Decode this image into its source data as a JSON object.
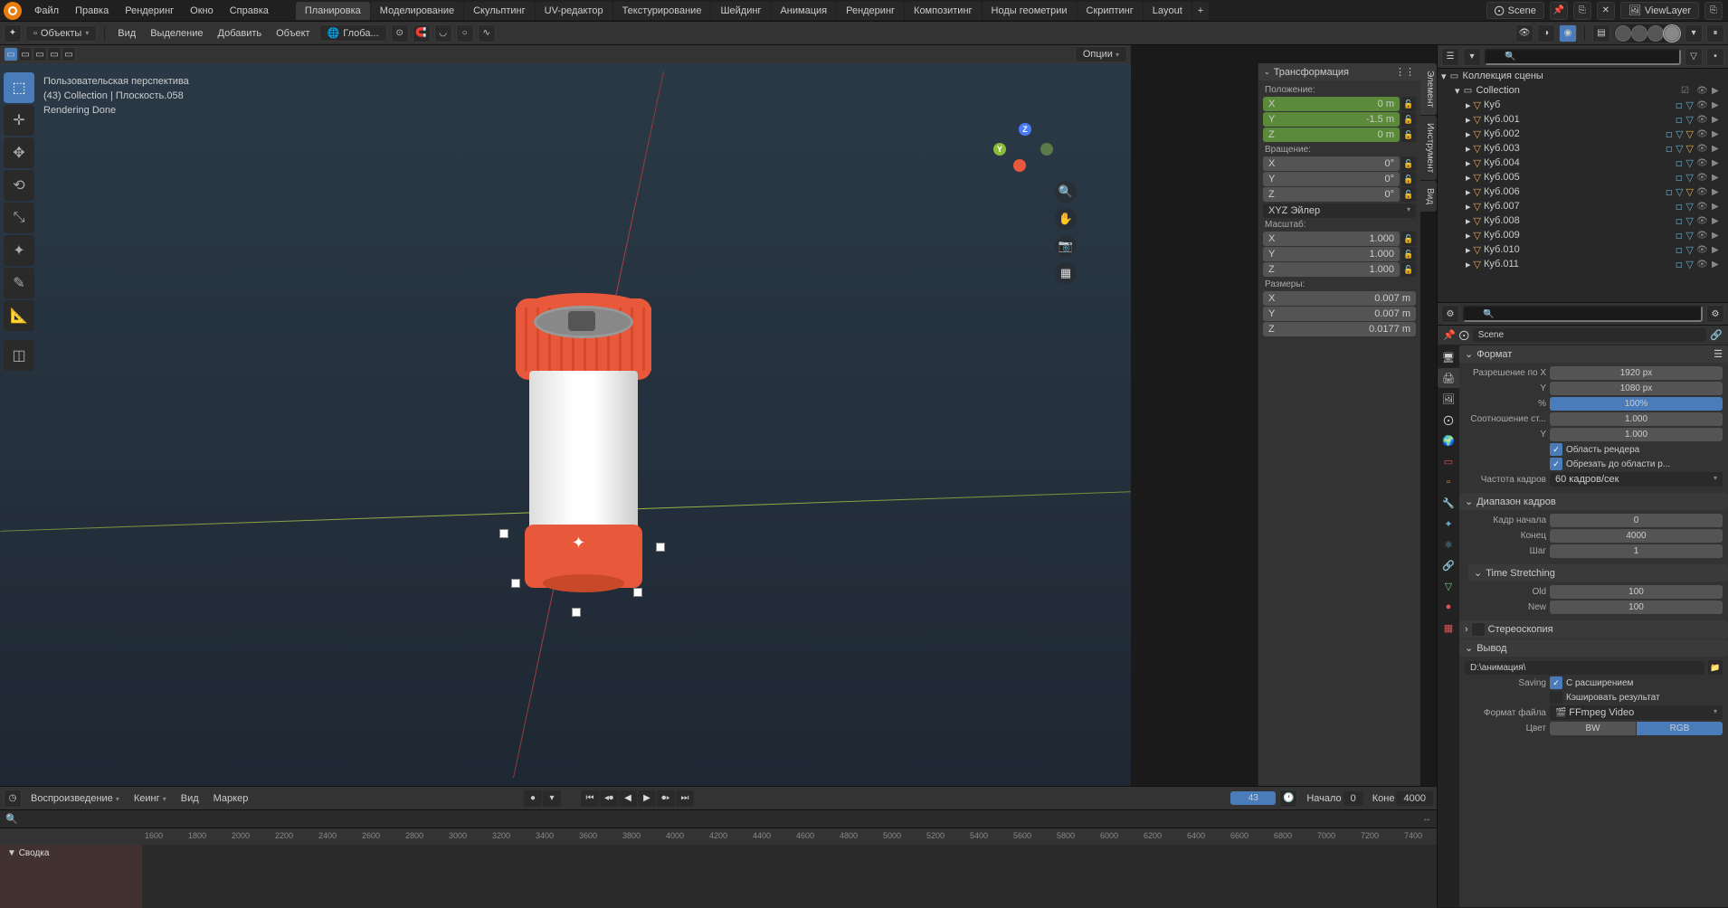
{
  "topmenu": {
    "file": "Файл",
    "edit": "Правка",
    "render": "Рендеринг",
    "window": "Окно",
    "help": "Справка"
  },
  "workspaces": [
    "Планировка",
    "Моделирование",
    "Скульптинг",
    "UV-редактор",
    "Текстурирование",
    "Шейдинг",
    "Анимация",
    "Рендеринг",
    "Композитинг",
    "Ноды геометрии",
    "Скриптинг",
    "Layout"
  ],
  "active_workspace": 0,
  "scene_name": "Scene",
  "viewlayer_name": "ViewLayer",
  "header": {
    "mode": "Объекты",
    "view": "Вид",
    "select": "Выделение",
    "add": "Добавить",
    "object": "Объект",
    "orient": "Глоба...",
    "options": "Опции"
  },
  "viewport": {
    "persp": "Пользовательская перспектива",
    "context": "(43) Collection | Плоскость.058",
    "status": "Rendering Done"
  },
  "npanel": {
    "tabs": [
      "Элемент",
      "Инструмент",
      "Вид"
    ],
    "transform": "Трансформация",
    "location": "Положение:",
    "rotation": "Вращение:",
    "scale": "Масштаб:",
    "dimensions": "Размеры:",
    "loc": [
      {
        "a": "X",
        "v": "0 m"
      },
      {
        "a": "Y",
        "v": "-1.5 m"
      },
      {
        "a": "Z",
        "v": "0 m"
      }
    ],
    "rot": [
      {
        "a": "X",
        "v": "0°"
      },
      {
        "a": "Y",
        "v": "0°"
      },
      {
        "a": "Z",
        "v": "0°"
      }
    ],
    "rotmode": "XYZ Эйлер",
    "scl": [
      {
        "a": "X",
        "v": "1.000"
      },
      {
        "a": "Y",
        "v": "1.000"
      },
      {
        "a": "Z",
        "v": "1.000"
      }
    ],
    "dim": [
      {
        "a": "X",
        "v": "0.007 m"
      },
      {
        "a": "Y",
        "v": "0.007 m"
      },
      {
        "a": "Z",
        "v": "0.0177 m"
      }
    ]
  },
  "outliner": {
    "title": "Коллекция сцены",
    "collection": "Collection",
    "items": [
      "Куб",
      "Куб.001",
      "Куб.002",
      "Куб.003",
      "Куб.004",
      "Куб.005",
      "Куб.006",
      "Куб.007",
      "Куб.008",
      "Куб.009",
      "Куб.010",
      "Куб.011"
    ]
  },
  "props": {
    "scene": "Scene",
    "format": "Формат",
    "reslabel_x": "Разрешение по X",
    "reslabel_y": "Y",
    "percent": "%",
    "res_x": "1920 px",
    "res_y": "1080 px",
    "res_pct": "100%",
    "aspect": "Соотношение ст...",
    "aspect_y": "Y",
    "aspect_xv": "1.000",
    "aspect_yv": "1.000",
    "render_region": "Область рендера",
    "crop": "Обрезать до области р...",
    "fps_label": "Частота кадров",
    "fps": "60 кадров/сек",
    "framerange": "Диапазон кадров",
    "start_l": "Кадр начала",
    "end_l": "Конец",
    "step_l": "Шаг",
    "start_v": "0",
    "end_v": "4000",
    "step_v": "1",
    "timestretch": "Time Stretching",
    "old_l": "Old",
    "new_l": "New",
    "old_v": "100",
    "new_v": "100",
    "stereo": "Стереоскопия",
    "output": "Вывод",
    "output_path": "D:\\анимация\\",
    "saving": "Saving",
    "ext": "С расширением",
    "cache": "Кэшировать результат",
    "fformat_l": "Формат файла",
    "fformat": "FFmpeg Video",
    "color_l": "Цвет",
    "bw": "BW",
    "rgb": "RGB"
  },
  "timeline": {
    "playback": "Воспроизведение",
    "keying": "Кеинг",
    "view": "Вид",
    "marker": "Маркер",
    "current_frame": "43",
    "start_l": "Начало",
    "start_v": "0",
    "end_l": "Коне",
    "end_v": "4000",
    "ticks": [
      "1600",
      "1800",
      "2000",
      "2200",
      "2400",
      "2600",
      "2800",
      "3000",
      "3200",
      "3400",
      "3600",
      "3800",
      "4000",
      "4200",
      "4400",
      "4600",
      "4800",
      "5000",
      "5200",
      "5400",
      "5600",
      "5800",
      "6000",
      "6200",
      "6400",
      "6600",
      "6800",
      "7000",
      "7200",
      "7400"
    ],
    "summary": "Сводка"
  }
}
